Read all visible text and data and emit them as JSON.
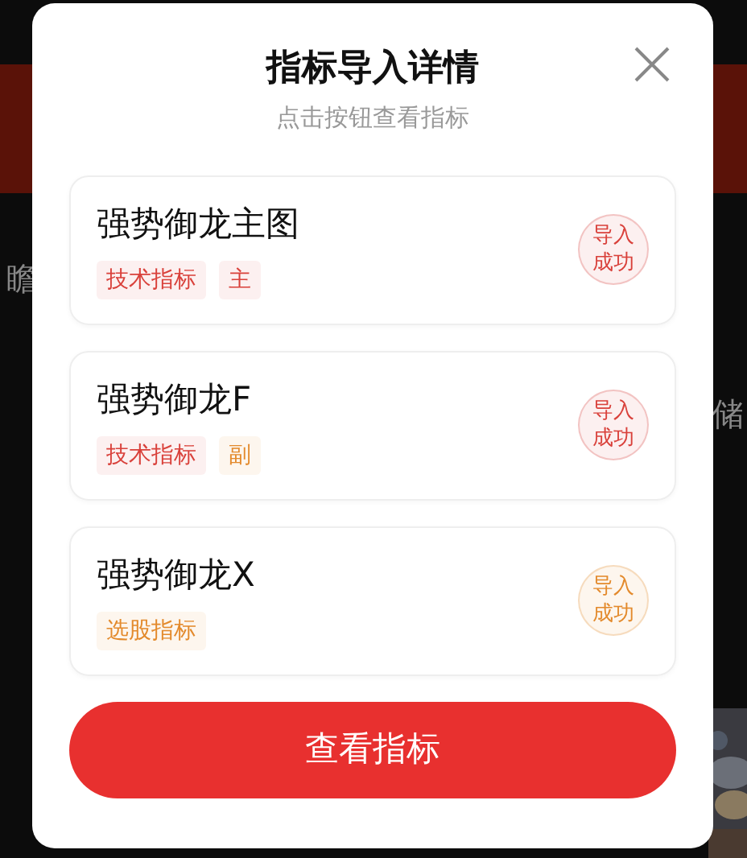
{
  "background": {
    "texts": [
      {
        "text": "瞻",
        "kind": "plain"
      },
      {
        "text": "储",
        "kind": "right"
      }
    ]
  },
  "dialog": {
    "title": "指标导入详情",
    "subtitle": "点击按钮查看指标",
    "items": [
      {
        "name": "强势御龙主图",
        "tags": [
          {
            "label": "技术指标",
            "color": "#d9413b"
          },
          {
            "label": "主",
            "color": "#d9413b"
          }
        ],
        "status": {
          "label": "导入成功",
          "color": "#d9413b"
        }
      },
      {
        "name": "强势御龙F",
        "tags": [
          {
            "label": "技术指标",
            "color": "#d9413b"
          },
          {
            "label": "副",
            "color": "#e38a2c"
          }
        ],
        "status": {
          "label": "导入成功",
          "color": "#d9413b"
        }
      },
      {
        "name": "强势御龙X",
        "tags": [
          {
            "label": "选股指标",
            "color": "#e38a2c"
          }
        ],
        "status": {
          "label": "导入成功",
          "color": "#e38a2c"
        }
      }
    ],
    "button": "查看指标"
  }
}
